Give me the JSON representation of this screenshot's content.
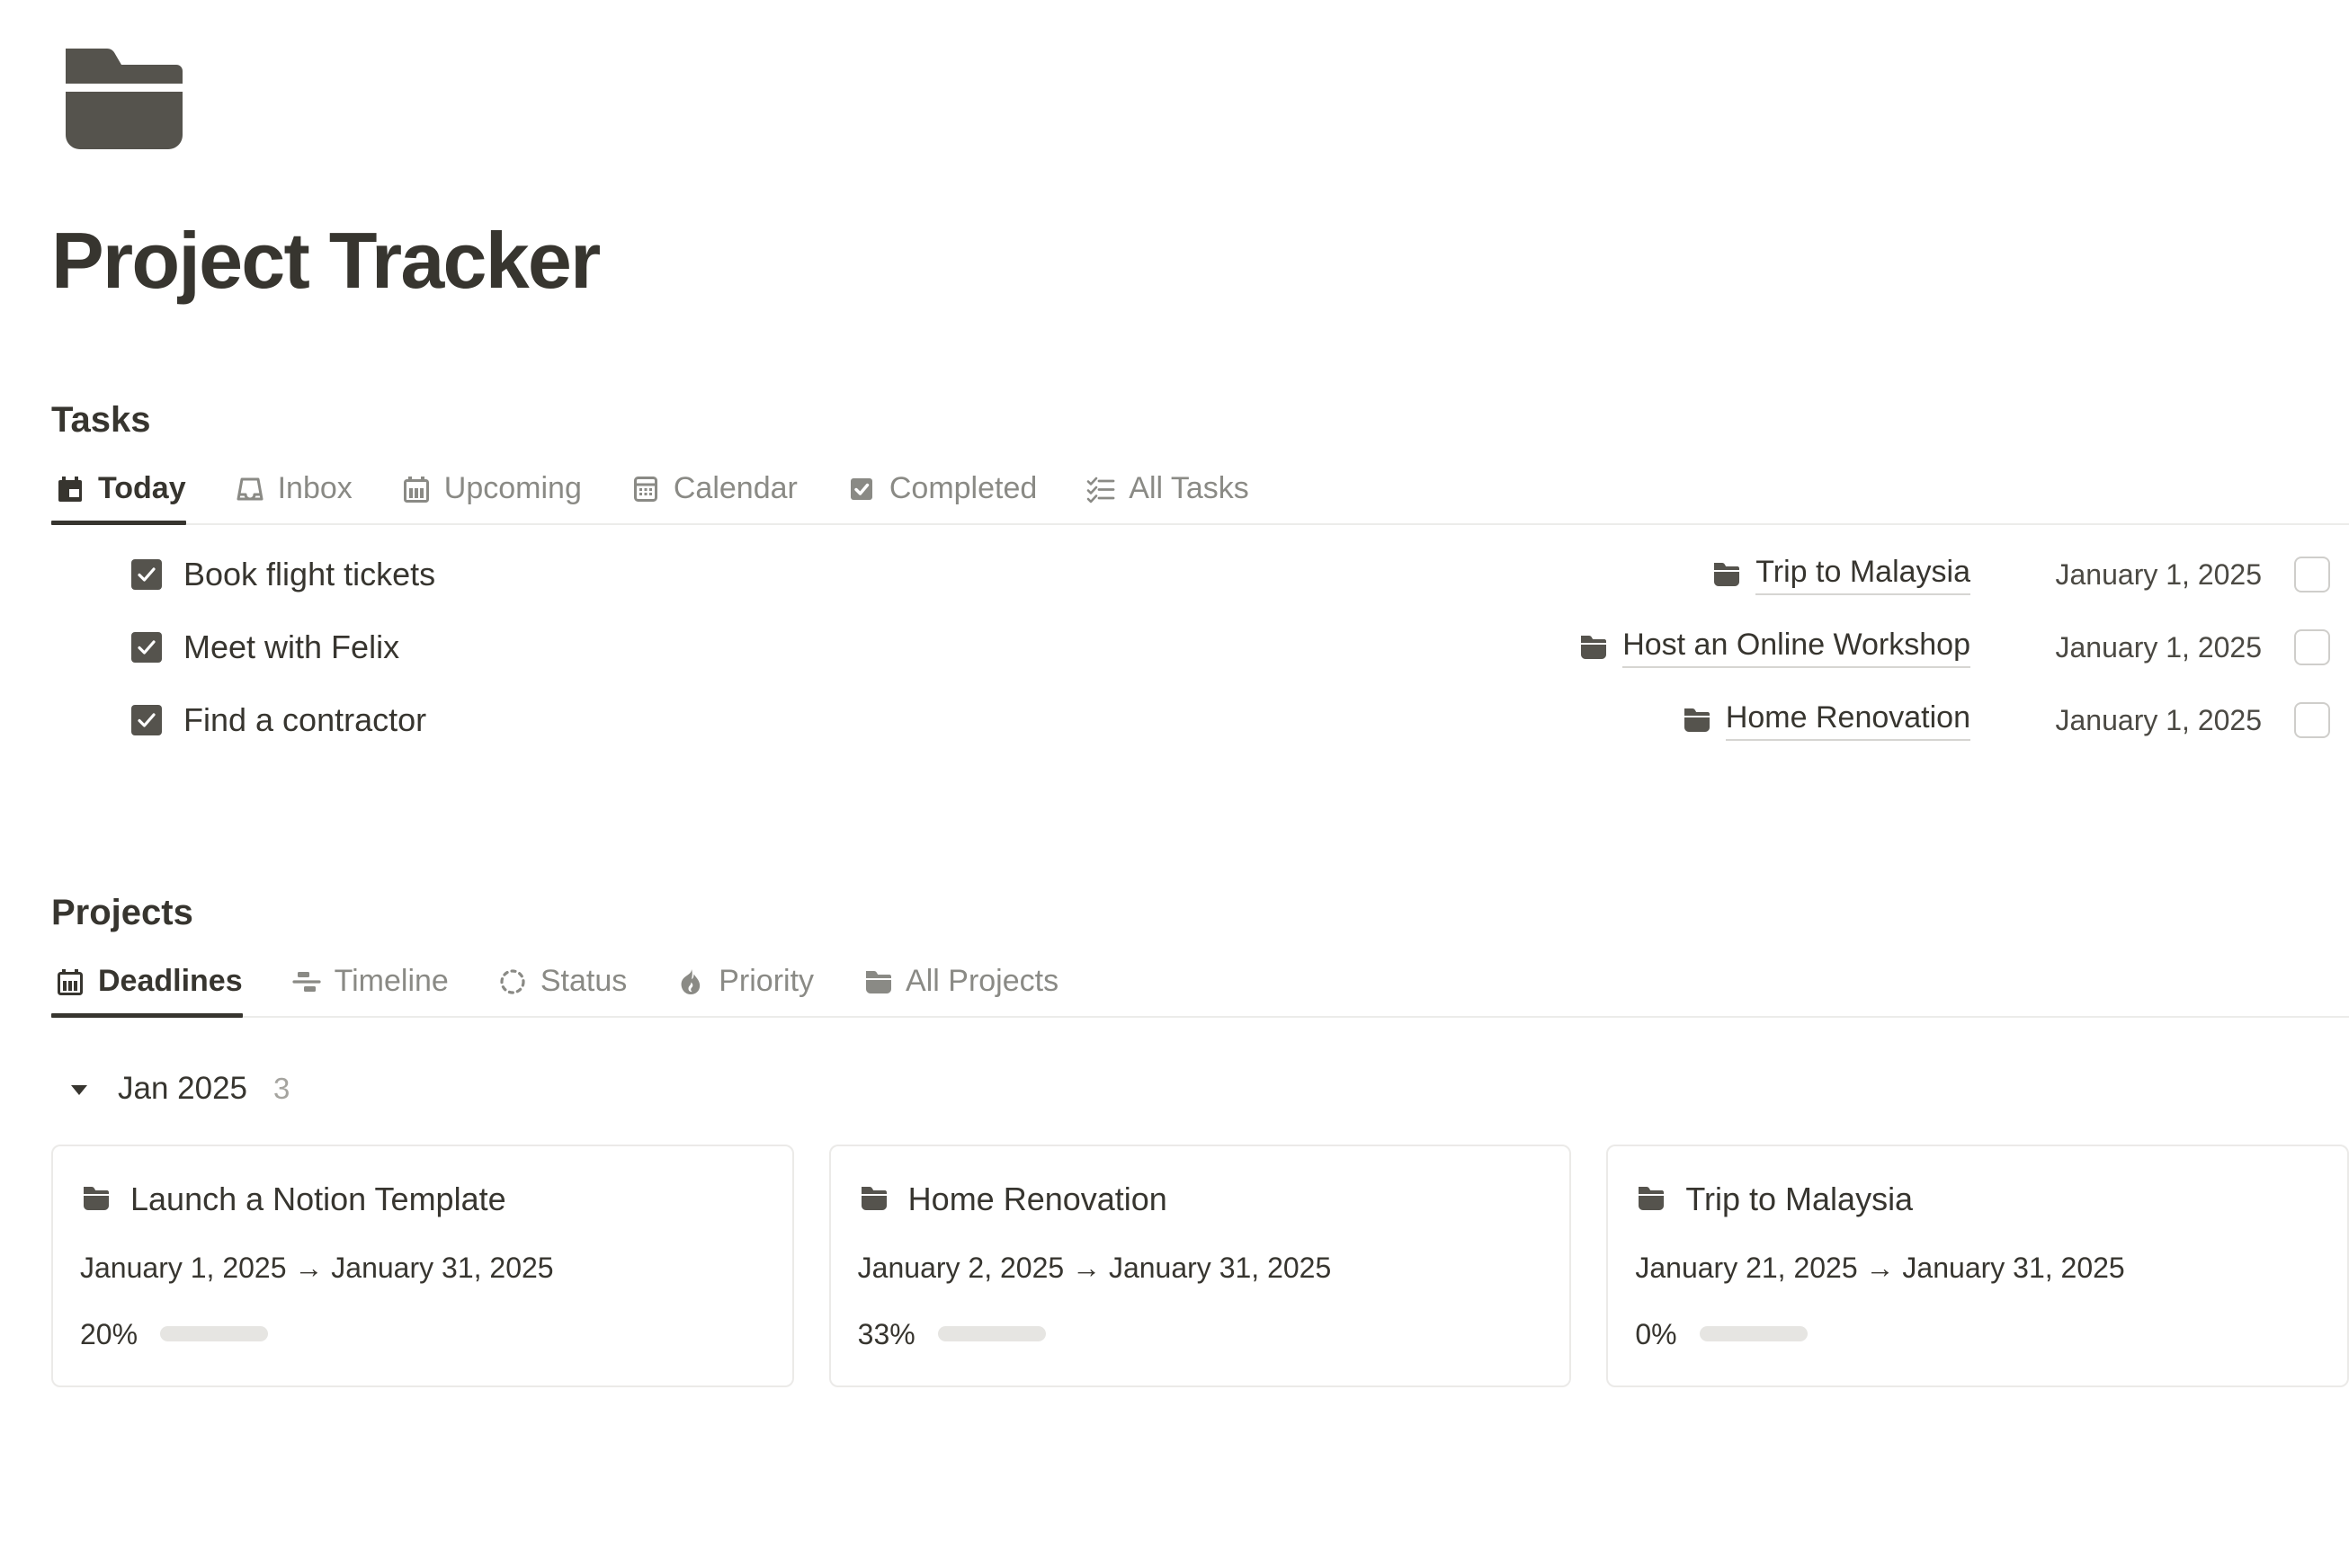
{
  "page": {
    "icon": "folder-icon",
    "title": "Project Tracker"
  },
  "tasks_section": {
    "heading": "Tasks",
    "tabs": [
      {
        "label": "Today",
        "icon": "calendar-day-icon",
        "active": true
      },
      {
        "label": "Inbox",
        "icon": "inbox-tray-icon",
        "active": false
      },
      {
        "label": "Upcoming",
        "icon": "calendar-bars-icon",
        "active": false
      },
      {
        "label": "Calendar",
        "icon": "calendar-dots-icon",
        "active": false
      },
      {
        "label": "Completed",
        "icon": "checkbox-checked-icon",
        "active": false
      },
      {
        "label": "All Tasks",
        "icon": "checklist-icon",
        "active": false
      }
    ],
    "rows": [
      {
        "checked": true,
        "title": "Book flight tickets",
        "project": "Trip to Malaysia",
        "date": "January 1, 2025"
      },
      {
        "checked": true,
        "title": "Meet with Felix",
        "project": "Host an Online Workshop",
        "date": "January 1, 2025"
      },
      {
        "checked": true,
        "title": "Find a contractor",
        "project": "Home Renovation",
        "date": "January 1, 2025"
      }
    ]
  },
  "projects_section": {
    "heading": "Projects",
    "tabs": [
      {
        "label": "Deadlines",
        "icon": "calendar-bars-icon",
        "active": true
      },
      {
        "label": "Timeline",
        "icon": "gantt-icon",
        "active": false
      },
      {
        "label": "Status",
        "icon": "dashed-circle-icon",
        "active": false
      },
      {
        "label": "Priority",
        "icon": "flame-icon",
        "active": false
      },
      {
        "label": "All Projects",
        "icon": "folder-icon",
        "active": false
      }
    ],
    "group": {
      "caret": "caret-down-icon",
      "name": "Jan 2025",
      "count": "3"
    },
    "cards": [
      {
        "title": "Launch a Notion Template",
        "dates": "January 1, 2025 → January 31, 2025",
        "percent_label": "20%",
        "percent_value": 20
      },
      {
        "title": "Home Renovation",
        "dates": "January 2, 2025 → January 31, 2025",
        "percent_label": "33%",
        "percent_value": 33
      },
      {
        "title": "Trip to Malaysia",
        "dates": "January 21, 2025 → January 31, 2025",
        "percent_label": "0%",
        "percent_value": 0
      }
    ]
  },
  "colors": {
    "text_primary": "#37352f",
    "text_muted": "#8a8a85",
    "icon_dark": "#55534d",
    "divider": "#ececea",
    "card_border": "#ebeae8",
    "bar_track": "#e6e5e2",
    "bar_fill": "#b9b8b4"
  }
}
